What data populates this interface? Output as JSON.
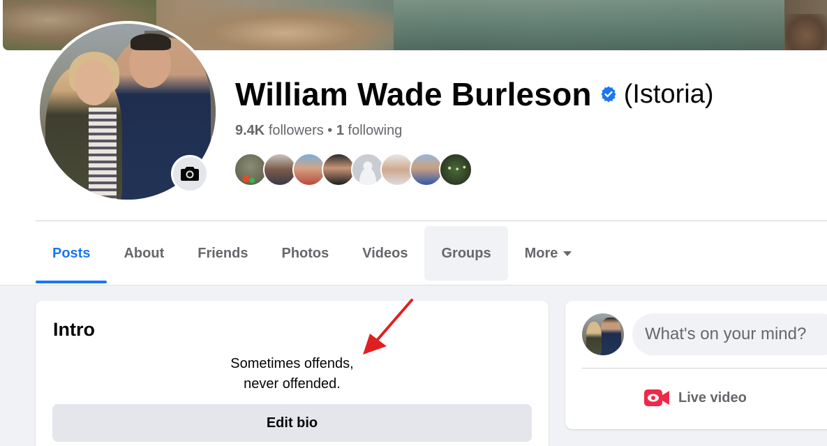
{
  "profile": {
    "name": "William Wade Burleson",
    "alternate_name": "(Istoria)",
    "followers": "9.4K",
    "followers_label": "followers",
    "separator": " • ",
    "following": "1",
    "following_label": "following"
  },
  "tabs": [
    {
      "label": "Posts",
      "active": true
    },
    {
      "label": "About"
    },
    {
      "label": "Friends"
    },
    {
      "label": "Photos"
    },
    {
      "label": "Videos"
    },
    {
      "label": "Groups",
      "hovered": true
    },
    {
      "label": "More"
    }
  ],
  "intro": {
    "title": "Intro",
    "bio_line1": "Sometimes offends,",
    "bio_line2": "never offended.",
    "edit_bio_label": "Edit bio"
  },
  "composer": {
    "placeholder": "What's on your mind?",
    "live_video_label": "Live video"
  },
  "icons": {
    "verified": "verified-badge-icon",
    "camera": "camera-icon",
    "more_caret": "caret-down-icon",
    "live_video": "live-video-icon"
  },
  "colors": {
    "accent": "#1877f2",
    "live_red": "#f02849",
    "annotation_arrow": "#e02020"
  }
}
